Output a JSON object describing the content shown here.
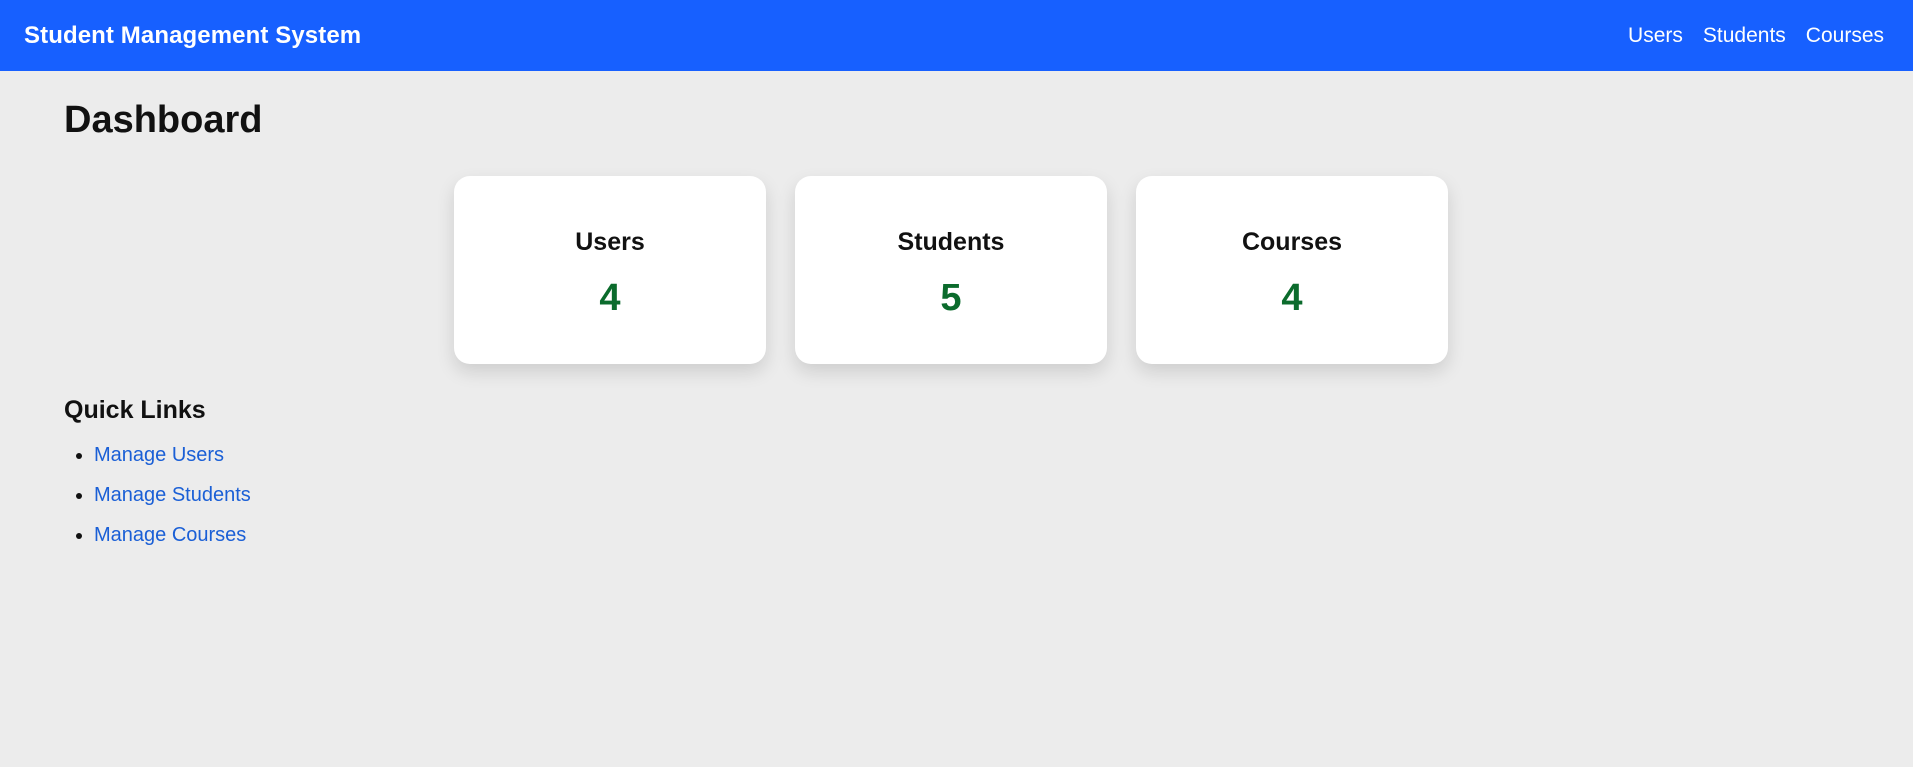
{
  "header": {
    "brand": "Student Management System",
    "nav": [
      {
        "label": "Users"
      },
      {
        "label": "Students"
      },
      {
        "label": "Courses"
      }
    ]
  },
  "main": {
    "title": "Dashboard",
    "cards": [
      {
        "label": "Users",
        "value": "4"
      },
      {
        "label": "Students",
        "value": "5"
      },
      {
        "label": "Courses",
        "value": "4"
      }
    ],
    "quick_links": {
      "title": "Quick Links",
      "items": [
        {
          "label": "Manage Users"
        },
        {
          "label": "Manage Students"
        },
        {
          "label": "Manage Courses"
        }
      ]
    }
  },
  "colors": {
    "navbar_bg": "#1760ff",
    "page_bg": "#ececec",
    "card_value": "#0b6b2c",
    "link": "#1a5fd6"
  }
}
